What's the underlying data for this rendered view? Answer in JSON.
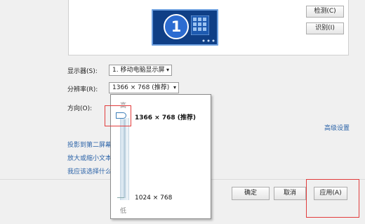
{
  "buttons": {
    "detect": "检测(C)",
    "identify": "识别(I)",
    "ok": "确定",
    "cancel": "取消",
    "apply": "应用(A)"
  },
  "monitor": {
    "number": "1"
  },
  "form": {
    "display_label": "显示器(S):",
    "display_value": "1. 移动电脑显示屏",
    "resolution_label": "分辨率(R):",
    "resolution_value": "1366 × 768 (推荐)",
    "orientation_label": "方向(O):"
  },
  "slider": {
    "high_label": "高",
    "low_label": "低",
    "max_option": "1366 × 768 (推荐)",
    "min_option": "1024 × 768",
    "selected": "1366 × 768 (推荐)"
  },
  "links": {
    "advanced": "高级设置",
    "project": "投影到第二屏幕",
    "text_size": "放大或缩小文本",
    "which_settings": "我应该选择什么"
  },
  "colors": {
    "annotation_red": "#e23c3c",
    "link_blue": "#2b63a8",
    "monitor_blue": "#0f3f86"
  },
  "icons": {
    "dropdown": "chevron-down-icon",
    "monitor": "monitor-icon"
  }
}
